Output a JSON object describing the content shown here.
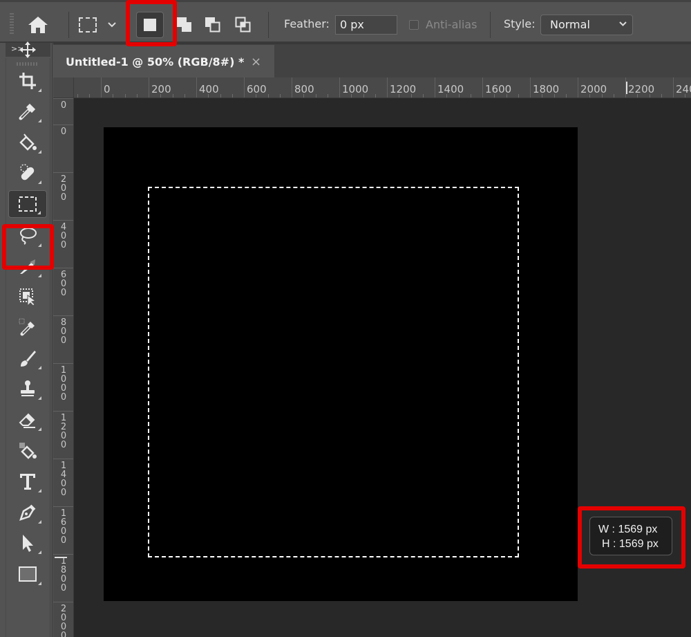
{
  "options_bar": {
    "home_icon": "home-icon",
    "tool_preset_icon": "rectangular-marquee-icon",
    "selection_modes": [
      {
        "name": "new-selection",
        "selected": true
      },
      {
        "name": "add-to-selection",
        "selected": false
      },
      {
        "name": "subtract-from-selection",
        "selected": false
      },
      {
        "name": "intersect-with-selection",
        "selected": false
      }
    ],
    "feather_label": "Feather:",
    "feather_value": "0 px",
    "anti_alias_label": "Anti-alias",
    "anti_alias_checked": false,
    "anti_alias_enabled": false,
    "style_label": "Style:",
    "style_value": "Normal"
  },
  "toolbar": {
    "collapse_label": ">>",
    "tools": [
      {
        "name": "move-tool",
        "active": false
      },
      {
        "name": "crop-tool",
        "active": false
      },
      {
        "name": "eyedropper-tool",
        "active": false
      },
      {
        "name": "paint-bucket-tool",
        "active": false
      },
      {
        "name": "healing-brush-tool",
        "active": false
      },
      {
        "name": "rectangular-marquee-tool",
        "active": true
      },
      {
        "name": "lasso-tool",
        "active": false
      },
      {
        "name": "object-selection-tool",
        "active": false
      },
      {
        "name": "select-subject-tool",
        "active": false
      },
      {
        "name": "color-sampler-tool",
        "active": false
      },
      {
        "name": "brush-tool",
        "active": false
      },
      {
        "name": "clone-stamp-tool",
        "active": false
      },
      {
        "name": "eraser-tool",
        "active": false
      },
      {
        "name": "fill-pattern-tool",
        "active": false
      },
      {
        "name": "type-tool",
        "active": false
      },
      {
        "name": "pen-tool",
        "active": false
      },
      {
        "name": "path-selection-tool",
        "active": false
      },
      {
        "name": "rectangle-tool",
        "active": false
      }
    ]
  },
  "document_tab": {
    "title": "Untitled-1 @ 50% (RGB/8#) *",
    "close_symbol": "×"
  },
  "ruler_horizontal": {
    "labels": [
      "0",
      "0",
      "200",
      "400",
      "600",
      "800",
      "1000",
      "1200",
      "1400",
      "1600",
      "1800",
      "2000",
      "2200",
      "240"
    ]
  },
  "ruler_vertical": {
    "labels": [
      "0",
      "0",
      "200",
      "400",
      "600",
      "800",
      "1000",
      "1200",
      "1400",
      "1600",
      "1800",
      "2000"
    ]
  },
  "selection_size": {
    "width_label": "W :",
    "width_value": "1569 px",
    "height_label": "H :",
    "height_value": "1569 px"
  },
  "colors": {
    "highlight": "#e50000",
    "canvas_fill": "#000000",
    "workspace_bg": "#282828",
    "ui_bg": "#535353"
  }
}
